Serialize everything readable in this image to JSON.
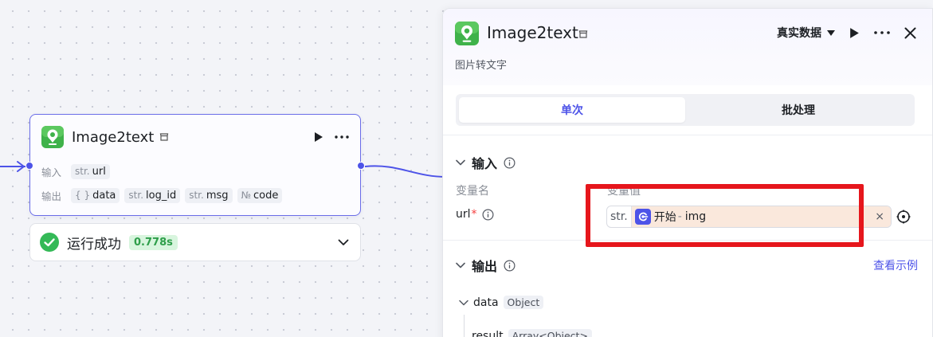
{
  "node": {
    "title": "Image2text",
    "input_label": "输入",
    "output_label": "输出",
    "inputs": [
      {
        "type": "str.",
        "name": "url"
      }
    ],
    "outputs": [
      {
        "type": "{ }",
        "name": "data"
      },
      {
        "type": "str.",
        "name": "log_id"
      },
      {
        "type": "str.",
        "name": "msg"
      },
      {
        "type": "№",
        "name": "code"
      }
    ]
  },
  "status": {
    "text": "运行成功",
    "time": "0.778s"
  },
  "panel": {
    "title": "Image2text",
    "description": "图片转文字",
    "data_select": "真实数据",
    "tabs": [
      {
        "label": "单次",
        "active": true
      },
      {
        "label": "批处理",
        "active": false
      }
    ],
    "input_section": "输入",
    "col_var_name": "变量名",
    "col_var_value": "变量值",
    "param": {
      "name": "url",
      "required_mark": "*",
      "type": "str.",
      "ref_node": "开始",
      "ref_sep": "-",
      "ref_var": "img",
      "clear": "×"
    },
    "output_section": "输出",
    "view_example": "查看示例",
    "output_tree": [
      {
        "name": "data",
        "type": "Object"
      },
      {
        "name": "result",
        "type": "Array<Object>"
      }
    ]
  },
  "colors": {
    "accent": "#4d53e8",
    "success": "#2e9e4a",
    "highlight": "#e6161c"
  }
}
